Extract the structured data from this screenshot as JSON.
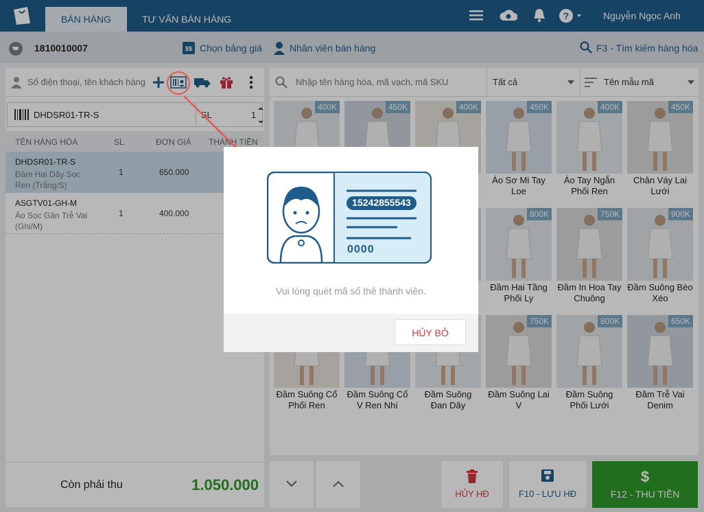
{
  "topbar": {
    "tabs": [
      "BÁN HÀNG",
      "TƯ VẤN BÁN HÀNG"
    ],
    "username": "Nguyễn Ngọc Anh"
  },
  "subbar": {
    "order_code": "1810010007",
    "price_list": "Chọn bảng giá",
    "staff": "Nhân viên bán hàng",
    "search": "F3 - Tìm kiếm hàng hóa"
  },
  "customer": {
    "placeholder": "Số điện thoại, tên khách hàng"
  },
  "product_input": {
    "code": "DHDSR01-TR-S",
    "sl_label": "SL",
    "qty": "1"
  },
  "cart": {
    "headers": [
      "TÊN HÀNG HÓA",
      "SL",
      "ĐƠN GIÁ",
      "THÀNH TIỀN"
    ],
    "rows": [
      {
        "code": "DHDSR01-TR-S",
        "name": "Đầm Hai Dây Sọc Ren (Trắng/S)",
        "qty": "1",
        "price": "650.000"
      },
      {
        "code": "ASGTV01-GH-M",
        "name": "Áo Sọc Gân Trễ Vai (Ghi/M)",
        "qty": "1",
        "price": "400.000"
      }
    ],
    "due_label": "Còn phải thu",
    "due_amount": "1.050.000"
  },
  "catalog": {
    "search_placeholder": "Nhập tên hàng hóa, mã vạch, mã SKU",
    "filter": "Tất cả",
    "sort": "Tên mẫu mã",
    "items": [
      {
        "price": "400K",
        "title": ""
      },
      {
        "price": "450K",
        "title": ""
      },
      {
        "price": "400K",
        "title": ""
      },
      {
        "price": "450K",
        "title": "Áo Sơ Mi Tay Loe"
      },
      {
        "price": "400K",
        "title": "Áo Tay Ngắn Phối Ren"
      },
      {
        "price": "450K",
        "title": "Chân Váy Lai Lưới"
      },
      {
        "price": "",
        "title": ""
      },
      {
        "price": "",
        "title": ""
      },
      {
        "price": "",
        "title": ""
      },
      {
        "price": "800K",
        "title": "Đầm Hai Tầng Phối Ly"
      },
      {
        "price": "750K",
        "title": "Đầm In Hoa Tay Chuông"
      },
      {
        "price": "900K",
        "title": "Đầm Suông Bèo Xéo"
      },
      {
        "price": "",
        "title": "Đầm Suông Cổ Phối Ren"
      },
      {
        "price": "",
        "title": "Đầm Suông Cổ V Ren Nhí"
      },
      {
        "price": "",
        "title": "Đầm Suông Đan Dây"
      },
      {
        "price": "750K",
        "title": "Đầm Suông Lai V"
      },
      {
        "price": "800K",
        "title": "Đầm Suông Phối Lưới"
      },
      {
        "price": "650K",
        "title": "Đầm Trễ Vai Denim"
      }
    ]
  },
  "actions": {
    "cancel": "HỦY HĐ",
    "save": "F10 - LƯU HĐ",
    "pay": "F12 - THU TIỀN"
  },
  "modal": {
    "card_number": "15242855543",
    "card_pin": "0000",
    "message": "Vui lòng quét mã số thẻ thành viên.",
    "cancel": "HỦY BỎ"
  },
  "colors": {
    "brand": "#1f5c8a",
    "pay": "#2e9a2a",
    "cancel": "#d9343b"
  }
}
